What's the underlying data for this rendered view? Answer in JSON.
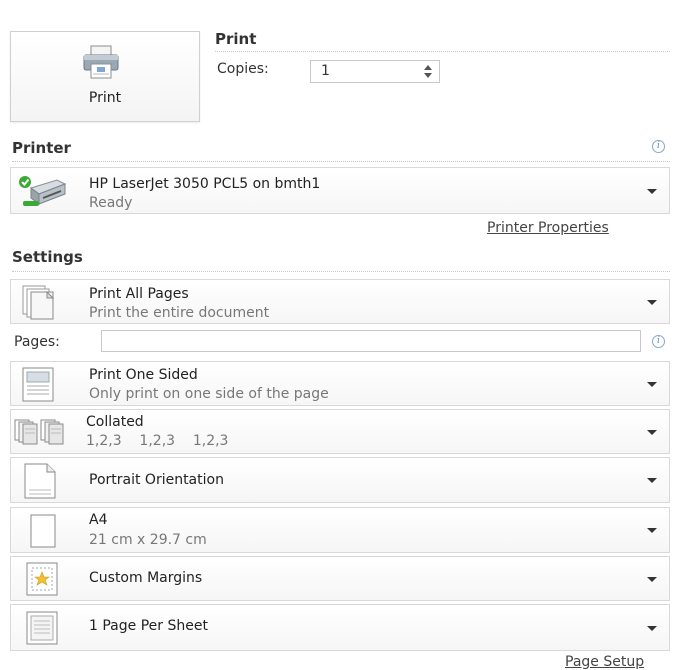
{
  "print_button": {
    "label": "Print",
    "icon": "printer-icon"
  },
  "print_section": {
    "title": "Print",
    "copies_label": "Copies:",
    "copies_value": "1"
  },
  "printer": {
    "section_title": "Printer",
    "name": "HP LaserJet 3050 PCL5 on bmth1",
    "status": "Ready",
    "properties_link": "Printer Properties"
  },
  "settings": {
    "section_title": "Settings",
    "print_range": {
      "title": "Print All Pages",
      "subtitle": "Print the entire document"
    },
    "pages_label": "Pages:",
    "pages_value": "",
    "sides": {
      "title": "Print One Sided",
      "subtitle": "Only print on one side of the page"
    },
    "collation": {
      "title": "Collated",
      "subtitle": "1,2,3    1,2,3    1,2,3"
    },
    "orientation": {
      "title": "Portrait Orientation"
    },
    "paper": {
      "title": "A4",
      "subtitle": "21 cm x 29.7 cm"
    },
    "margins": {
      "title": "Custom Margins"
    },
    "pages_per_sheet": {
      "title": "1 Page Per Sheet"
    },
    "page_setup_link": "Page Setup"
  },
  "colors": {
    "status_ready": "#3aa935",
    "link": "#444444",
    "info": "#5b86b8"
  }
}
